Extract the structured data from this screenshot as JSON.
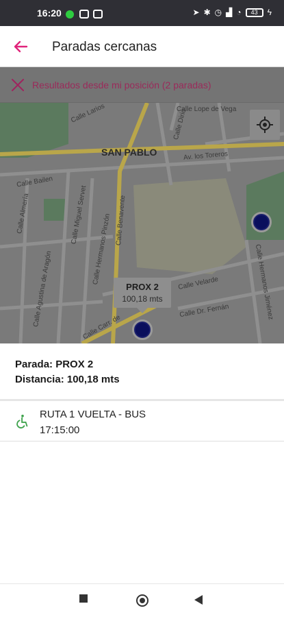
{
  "status_bar": {
    "time": "16:20",
    "battery": "43"
  },
  "app_bar": {
    "title": "Paradas cercanas",
    "back_icon": "arrow-back-icon"
  },
  "results": {
    "text": "Resultados desde mi posición (2 paradas)",
    "close_icon": "close-icon"
  },
  "map": {
    "labels": {
      "san_pablo": "SAN PABLO",
      "calle_lopez_de_vega": "Calle Lope de Vega",
      "calle_larios": "Calle Larios",
      "calle_dirio": "Calle Dirio",
      "av_los_toreros": "Av. los Toreros",
      "calle_bailen": "Calle Bailen",
      "calle_almeria": "Calle Almería",
      "calle_miguel_servet": "Calle Miguel Servet",
      "calle_hermanos_pinzon": "Calle Hermanos Pinzón",
      "calle_banavente": "Calle Benavente",
      "calle_aguirre_de_aragon": "Calle Agustina de Aragón",
      "calle_hermanos_jimenez": "Calle Hermanos Jiménez",
      "calle_dr_fernan": "Calle Dr. Fernán",
      "calle_carr_de": "Calle Carr. de",
      "calle_velarde": "Calle Velarde"
    },
    "locate_icon": "my-location-icon",
    "callout": {
      "title": "PROX 2",
      "distance": "100,18 mts"
    }
  },
  "details": {
    "parada": "Parada: PROX 2",
    "distancia": "Distancia: 100,18 mts"
  },
  "route": {
    "name": "RUTA 1 VUELTA - BUS",
    "time": "17:15:00",
    "icon": "wheelchair-icon",
    "icon_color": "#3fa34d"
  },
  "colors": {
    "accent": "#e0237a",
    "marker": "#0a0f5c"
  }
}
